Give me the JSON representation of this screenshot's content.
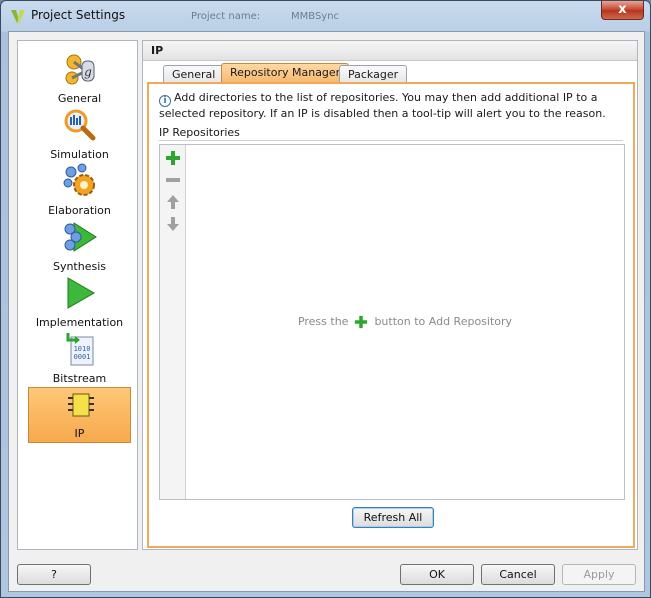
{
  "window": {
    "title": "Project Settings",
    "ghost_title_1": "Project name:",
    "ghost_title_2": "MMBSync",
    "close_glyph": "x"
  },
  "nav": {
    "items": [
      {
        "key": "general",
        "label": "General",
        "icon": "general-icon"
      },
      {
        "key": "simulation",
        "label": "Simulation",
        "icon": "simulation-icon"
      },
      {
        "key": "elaboration",
        "label": "Elaboration",
        "icon": "elaboration-icon"
      },
      {
        "key": "synthesis",
        "label": "Synthesis",
        "icon": "synthesis-icon"
      },
      {
        "key": "implementation",
        "label": "Implementation",
        "icon": "implementation-icon"
      },
      {
        "key": "bitstream",
        "label": "Bitstream",
        "icon": "bitstream-icon"
      },
      {
        "key": "ip",
        "label": "IP",
        "icon": "ip-chip-icon",
        "selected": true
      }
    ]
  },
  "panel": {
    "title": "IP",
    "tabs": [
      {
        "label": "General"
      },
      {
        "label": "Repository Manager",
        "active": true
      },
      {
        "label": "Packager"
      }
    ],
    "info_text": "Add directories to the list of repositories. You may then add additional IP to a selected repository. If an IP is disabled then a tool-tip will alert you to the reason.",
    "repositories_label": "IP Repositories",
    "empty_prefix": "Press the",
    "empty_suffix": "button to Add Repository",
    "refresh_button": "Refresh All"
  },
  "footer": {
    "help_button": "?",
    "ok_button": "OK",
    "cancel_button": "Cancel",
    "apply_button": "Apply"
  },
  "colors": {
    "accent_orange": "#f7a94c",
    "add_green": "#2ea52e",
    "titlebar_blue": "#b9cfe6"
  }
}
